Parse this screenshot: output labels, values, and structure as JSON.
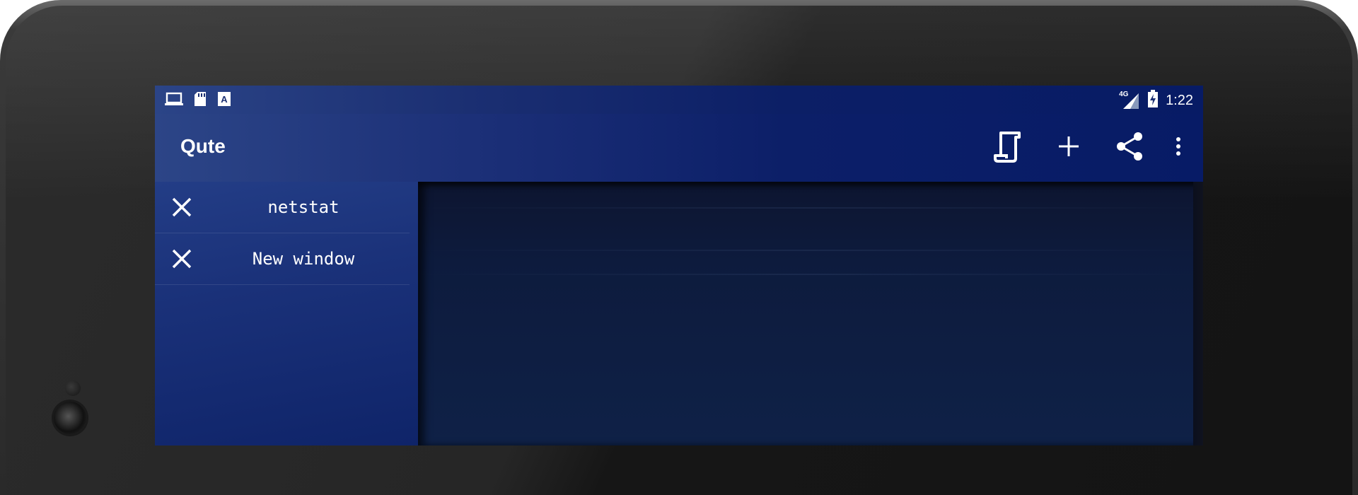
{
  "status_bar": {
    "left_icons": [
      "laptop-icon",
      "sd-card-icon",
      "keyboard-a-icon"
    ],
    "network_label": "4G",
    "time": "1:22"
  },
  "toolbar": {
    "title": "Qute",
    "actions": [
      "scroll-icon",
      "add-icon",
      "share-icon",
      "more-vert-icon"
    ]
  },
  "tabs": [
    {
      "label": "netstat",
      "close_icon": "close-icon"
    },
    {
      "label": "New window",
      "close_icon": "close-icon"
    }
  ],
  "colors": {
    "status_bar": "#1b2f72",
    "toolbar": "#0c1f68",
    "panel": "#1a3179",
    "terminal": "#0d1b3d",
    "text": "#ffffff"
  }
}
